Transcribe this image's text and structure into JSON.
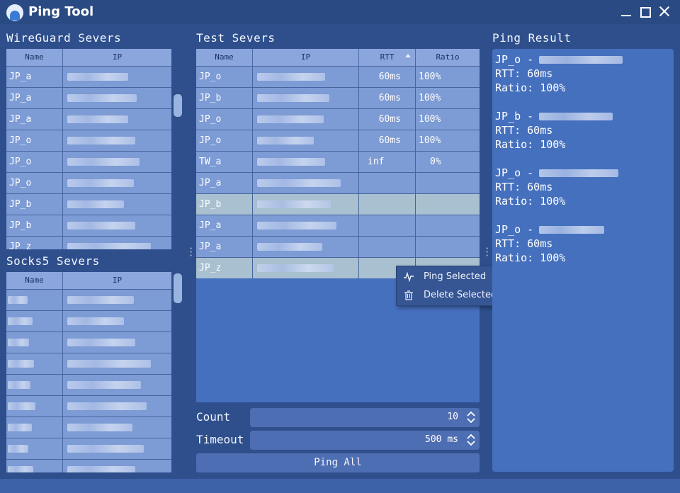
{
  "window": {
    "title": "Ping Tool"
  },
  "wireguard": {
    "title": "WireGuard Severs",
    "columns": [
      "Name",
      "IP"
    ],
    "rows": [
      {
        "name": "JP_a"
      },
      {
        "name": "JP_a"
      },
      {
        "name": "JP_a"
      },
      {
        "name": "JP_o"
      },
      {
        "name": "JP_o"
      },
      {
        "name": "JP_o"
      },
      {
        "name": "JP_b"
      },
      {
        "name": "JP_b"
      },
      {
        "name": "JP_z"
      }
    ]
  },
  "socks5": {
    "title": "Socks5 Severs",
    "columns": [
      "Name",
      "IP"
    ],
    "row_count": 9
  },
  "test": {
    "title": "Test Severs",
    "columns": [
      "Name",
      "IP",
      "RTT",
      "Ratio"
    ],
    "rows": [
      {
        "name": "JP_o",
        "rtt": "60ms",
        "ratio": "100%"
      },
      {
        "name": "JP_b",
        "rtt": "60ms",
        "ratio": "100%"
      },
      {
        "name": "JP_o",
        "rtt": "60ms",
        "ratio": "100%"
      },
      {
        "name": "JP_o",
        "rtt": "60ms",
        "ratio": "100%"
      },
      {
        "name": "TW_a",
        "rtt": "inf",
        "ratio": "0%"
      },
      {
        "name": "JP_a",
        "rtt": "",
        "ratio": ""
      },
      {
        "name": "JP_b",
        "rtt": "",
        "ratio": ""
      },
      {
        "name": "JP_a",
        "rtt": "",
        "ratio": ""
      },
      {
        "name": "JP_a",
        "rtt": "",
        "ratio": ""
      },
      {
        "name": "JP_z",
        "rtt": "",
        "ratio": ""
      }
    ]
  },
  "context_menu": {
    "ping_selected": "Ping Selected",
    "delete_selected": "Delete Selected"
  },
  "controls": {
    "count_label": "Count",
    "count_value": "10",
    "timeout_label": "Timeout",
    "timeout_value": "500 ms",
    "ping_all": "Ping All"
  },
  "result": {
    "title": "Ping Result",
    "entries": [
      {
        "name": "JP_o -",
        "rtt": "RTT: 60ms",
        "ratio": "Ratio: 100%"
      },
      {
        "name": "JP_b -",
        "rtt": "RTT: 60ms",
        "ratio": "Ratio: 100%"
      },
      {
        "name": "JP_o -",
        "rtt": "RTT: 60ms",
        "ratio": "Ratio: 100%"
      },
      {
        "name": "JP_o -",
        "rtt": "RTT: 60ms",
        "ratio": "Ratio: 100%"
      }
    ]
  }
}
